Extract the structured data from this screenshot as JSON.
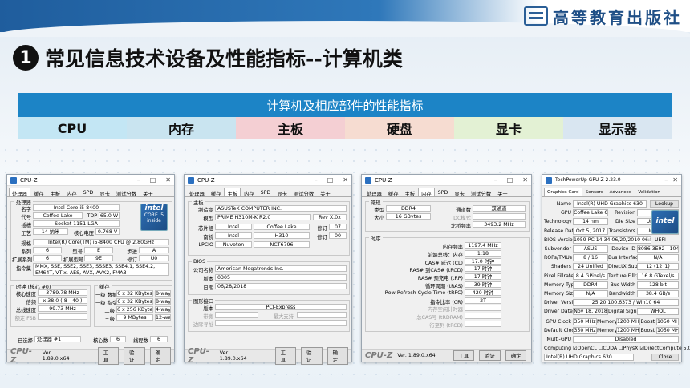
{
  "slide": {
    "publisher": "高等教育出版社",
    "num": "1",
    "title": "常见信息技术设备及性能指标--计算机类",
    "table_header": "计算机及相应部件的性能指标",
    "columns": [
      {
        "label": "CPU",
        "bg": "#c3e6f4"
      },
      {
        "label": "内存",
        "bg": "#c9e4f0"
      },
      {
        "label": "主板",
        "bg": "#f4cfd3"
      },
      {
        "label": "硬盘",
        "bg": "#f6dcd1"
      },
      {
        "label": "显卡",
        "bg": "#e3f1d4"
      },
      {
        "label": "显示器",
        "bg": "#d9e6f1"
      }
    ]
  },
  "cpuz_common": {
    "title": "CPU-Z",
    "brand": "CPU-Z",
    "version": "Ver. 1.89.0.x64",
    "tools": "工具",
    "validate": "验证",
    "ok": "确定",
    "tabs": [
      "处理器",
      "缓存",
      "主板",
      "内存",
      "SPD",
      "显卡",
      "测试分数",
      "关于"
    ]
  },
  "cpu": {
    "g_proc": "处理器",
    "name_l": "名字",
    "name": "Intel Core i5 8400",
    "code_l": "代号",
    "code": "Coffee Lake",
    "tdp_l": "TDP",
    "tdp": "65.0 W",
    "pkg_l": "插槽",
    "pkg": "Socket 1151 LGA",
    "tech_l": "工艺",
    "tech": "14 纳米",
    "volt_l": "核心电压",
    "volt": "0.768 V",
    "spec_l": "规格",
    "spec": "Intel(R) Core(TM) i5-8400 CPU @ 2.80GHz",
    "fam_l": "系列",
    "fam": "6",
    "model_l": "型号",
    "model": "E",
    "step_l": "步进",
    "step": "A",
    "efam_l": "扩展系列",
    "efam": "6",
    "emod_l": "扩展型号",
    "emod": "9E",
    "rev_l": "修订",
    "rev": "U0",
    "inst_l": "指令集",
    "inst": "MMX, SSE, SSE2, SSE3, SSSE3, SSE4.1, SSE4.2, EM64T, VT-x, AES, AVX, AVX2, FMA3",
    "g_clk": "时钟 (核心 #0)",
    "g_cache": "缓存",
    "cs_l": "核心速度",
    "cs": "3789.78 MHz",
    "mul_l": "倍频",
    "mul": "x 38.0 ( 8 - 40 )",
    "bus_l": "总线速度",
    "bus": "99.73 MHz",
    "fsb_l": "额定 FSB",
    "l1d_l": "一级 数据",
    "l1d": "6 x 32 KBytes",
    "l1d_w": "8-way",
    "l1i_l": "一级 指令",
    "l1i": "6 x 32 KBytes",
    "l1i_w": "8-way",
    "l2_l": "二级",
    "l2": "6 x 256 KBytes",
    "l2_w": "4-way",
    "l3_l": "三级",
    "l3": "9 MBytes",
    "l3_w": "12-way",
    "sel_l": "已选择",
    "sel": "处理器 #1",
    "cores_l": "核心数",
    "cores": "6",
    "thr_l": "线程数",
    "thr": "6",
    "intel_t": "intel",
    "intel_s": "CORE i5",
    "intel_i": "inside"
  },
  "mb": {
    "g_mb": "主板",
    "mfr_l": "制造商",
    "mfr": "ASUSTeK COMPUTER INC.",
    "model_l": "模型",
    "model": "PRIME H310M-K R2.0",
    "rev": "Rev X.0x",
    "chip_l": "芯片组",
    "chip": "Intel",
    "chip2": "Coffee Lake",
    "chipr_l": "修订",
    "chipr": "07",
    "sb_l": "南桥",
    "sb": "Intel",
    "sb2": "H310",
    "sbr_l": "修订",
    "sbr": "00",
    "lpc_l": "LPCIO",
    "lpc": "Nuvoton",
    "lpc2": "NCT6796",
    "g_bios": "BIOS",
    "brand_l": "公司名称",
    "brand": "American Megatrends Inc.",
    "ver_l": "版本",
    "ver": "0305",
    "date_l": "日期",
    "date": "06/28/2018",
    "g_gfx": "图形接口",
    "gver_l": "版本",
    "gver": "PCI-Express",
    "lw_l": "带宽",
    "mx_l": "最大支持",
    "sb3_l": "边际寻址"
  },
  "mem": {
    "g_gen": "常规",
    "type_l": "类型",
    "type": "DDR4",
    "ch_l": "通道数",
    "ch": "双通道",
    "size_l": "大小",
    "size": "16 GBytes",
    "dc_l": "DC模式",
    "nb_l": "北桥频率",
    "nb": "3493.2 MHz",
    "g_tim": "时序",
    "t": [
      {
        "l": "内存频率",
        "v": "1197.4 MHz"
      },
      {
        "l": "前端总线：内存",
        "v": "1:18"
      },
      {
        "l": "CAS# 延迟 (CL)",
        "v": "17.0 时钟"
      },
      {
        "l": "RAS# 到CAS# (tRCD)",
        "v": "17 时钟"
      },
      {
        "l": "RAS# 预充电 (tRP)",
        "v": "17 时钟"
      },
      {
        "l": "循环周期 (tRAS)",
        "v": "39 时钟"
      },
      {
        "l": "Row Refresh Cycle Time (tRFC)",
        "v": "420 时钟"
      },
      {
        "l": "指令比率 (CR)",
        "v": "2T"
      },
      {
        "l": "内存空闲计时器",
        "v": ""
      },
      {
        "l": "总CAS号 (tRDRAM)",
        "v": ""
      },
      {
        "l": "行至列 (tRCD)",
        "v": ""
      }
    ]
  },
  "gpuz": {
    "title": "TechPowerUp GPU-Z 2.23.0",
    "tabs": [
      "Graphics Card",
      "Sensors",
      "Advanced",
      "Validation"
    ],
    "rows": [
      {
        "l": "Name",
        "v": "Intel(R) UHD Graphics 630",
        "b": "Lookup"
      },
      {
        "l": "GPU",
        "v": "Coffee Lake GT2",
        "l2": "Revision",
        "v2": "N/A"
      },
      {
        "l": "Technology",
        "v": "14 nm",
        "l2": "Die Size",
        "v2": "Unknown"
      },
      {
        "l": "Release Date",
        "v": "Oct 5, 2017",
        "l2": "Transistors",
        "v2": "Unknown"
      },
      {
        "l": "BIOS Version",
        "v": "1059 PC 14.34 06/20/2010 06:50:53",
        "c": "UEFI"
      },
      {
        "l": "Subvendor",
        "v": "ASUS",
        "l2": "Device ID",
        "v2": "8086 3E92 - 1043 8694"
      },
      {
        "l": "ROPs/TMUs",
        "v": "8 / 16",
        "l2": "Bus Interface",
        "v2": "N/A"
      },
      {
        "l": "Shaders",
        "v": "24 Unified",
        "l2": "DirectX Support",
        "v2": "12 (12_1)"
      },
      {
        "l": "Pixel Fillrate",
        "v": "8.4 GPixel/s",
        "l2": "Texture Fillrate",
        "v2": "16.8 GTexel/s"
      },
      {
        "l": "Memory Type",
        "v": "DDR4",
        "l2": "Bus Width",
        "v2": "128 bit"
      },
      {
        "l": "Memory Size",
        "v": "N/A",
        "l2": "Bandwidth",
        "v2": "38.4 GB/s"
      },
      {
        "l": "Driver Version",
        "v": "25.20.100.6373 / Win10 64"
      },
      {
        "l": "Driver Date",
        "v": "Nov 18, 2018",
        "l2": "Digital Signature",
        "v2": "WHQL"
      }
    ],
    "clk": [
      {
        "l": "GPU Clock",
        "a": "350 MHz",
        "ml": "Memory",
        "m": "1200 MHz",
        "bl": "Boost",
        "b": "1050 MHz"
      },
      {
        "l": "Default Clock",
        "a": "350 MHz",
        "ml": "Memory",
        "m": "1200 MHz",
        "bl": "Boost",
        "b": "1050 MHz"
      }
    ],
    "multi_l": "Multi-GPU",
    "multi": "Disabled",
    "comp_l": "Computing",
    "comp": "☑OpenCL  ☐CUDA  ☐PhysX  ☑DirectCompute 5.0",
    "sel": "Intel(R) UHD Graphics 630",
    "close": "Close",
    "intel": "intel"
  }
}
